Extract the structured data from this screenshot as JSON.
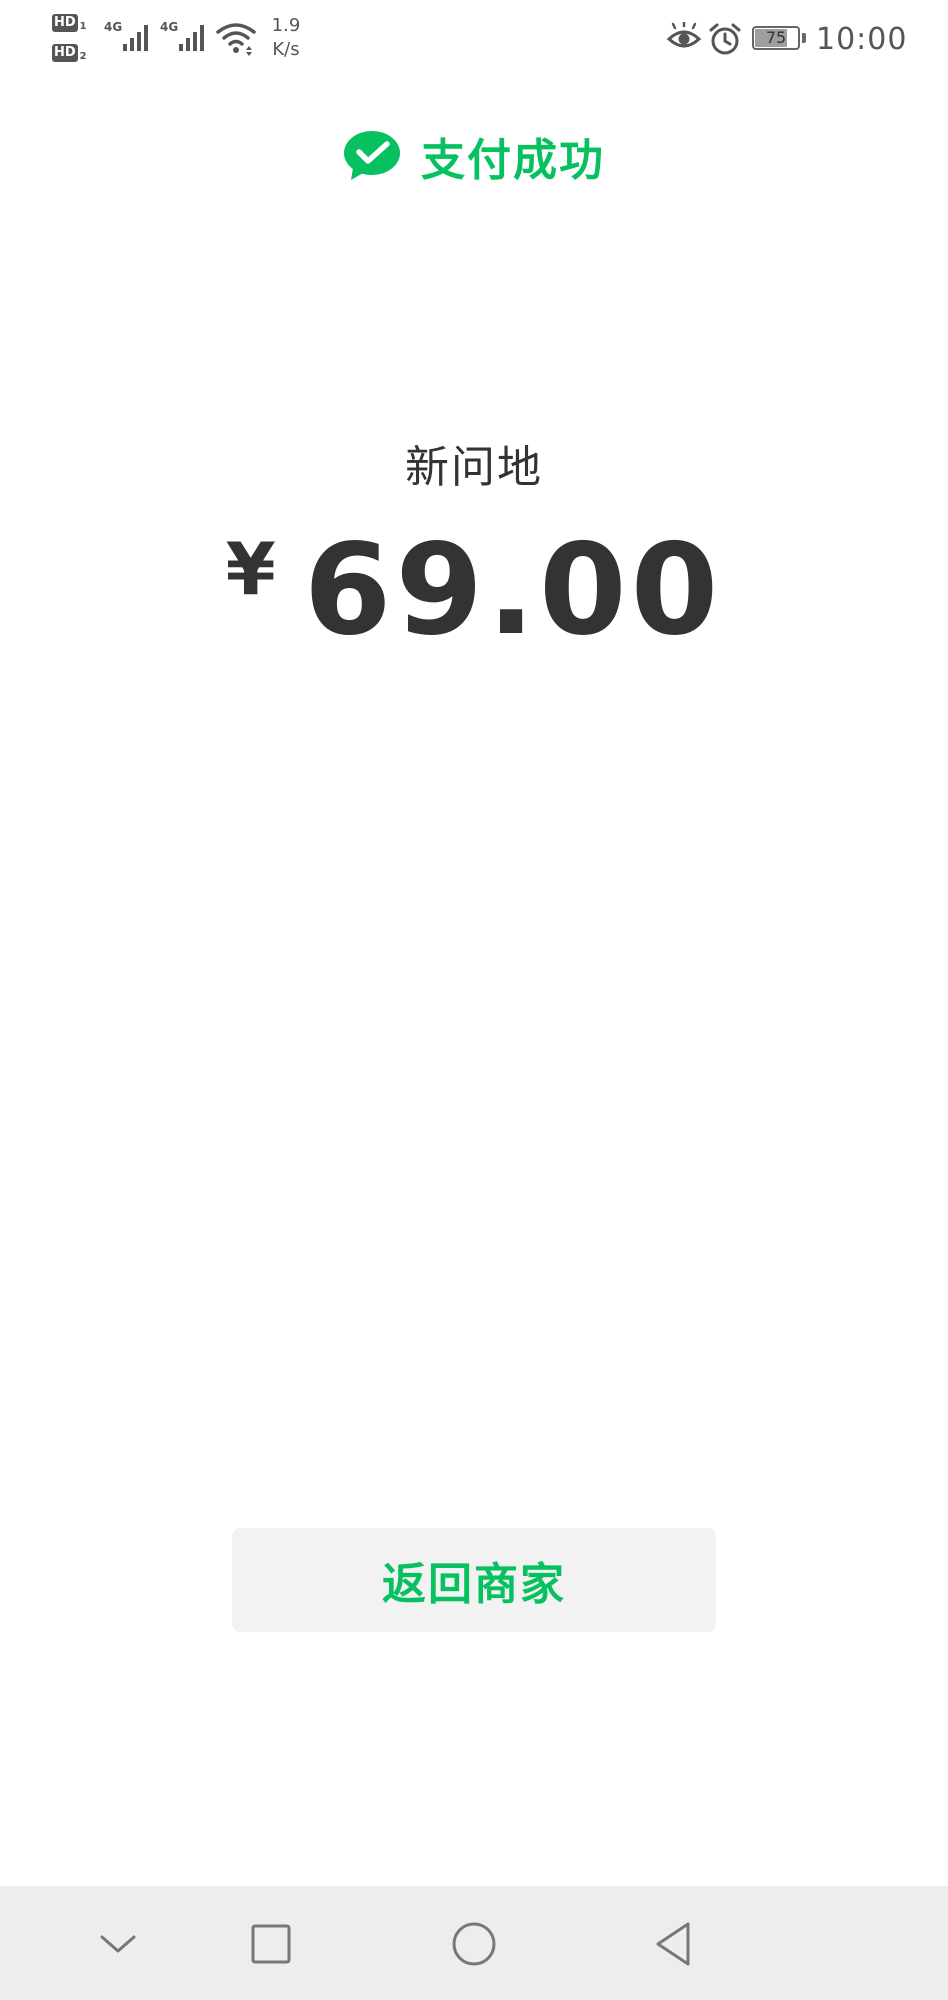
{
  "status_bar": {
    "sim1_label": "HD",
    "sim1_index": "1",
    "sim2_label": "HD",
    "sim2_index": "2",
    "network1": "4G",
    "network2": "4G",
    "speed_value": "1.9",
    "speed_unit": "K/s",
    "battery_level": "75",
    "time": "10:00",
    "icons": [
      "signal-icon",
      "wifi-icon",
      "eye-comfort-icon",
      "alarm-icon",
      "battery-icon"
    ]
  },
  "header": {
    "icon": "wechat-pay-icon",
    "title": "支付成功"
  },
  "payment": {
    "merchant": "新问地",
    "currency_symbol": "¥",
    "amount": "69.00"
  },
  "actions": {
    "return_label": "返回商家"
  },
  "nav_bar": {
    "icons": [
      "chevron-down-icon",
      "recent-apps-icon",
      "home-icon",
      "back-icon"
    ]
  },
  "colors": {
    "accent": "#07C160",
    "text": "#333333",
    "button_bg": "#F2F2F2",
    "nav_bg": "#EDEDED"
  }
}
